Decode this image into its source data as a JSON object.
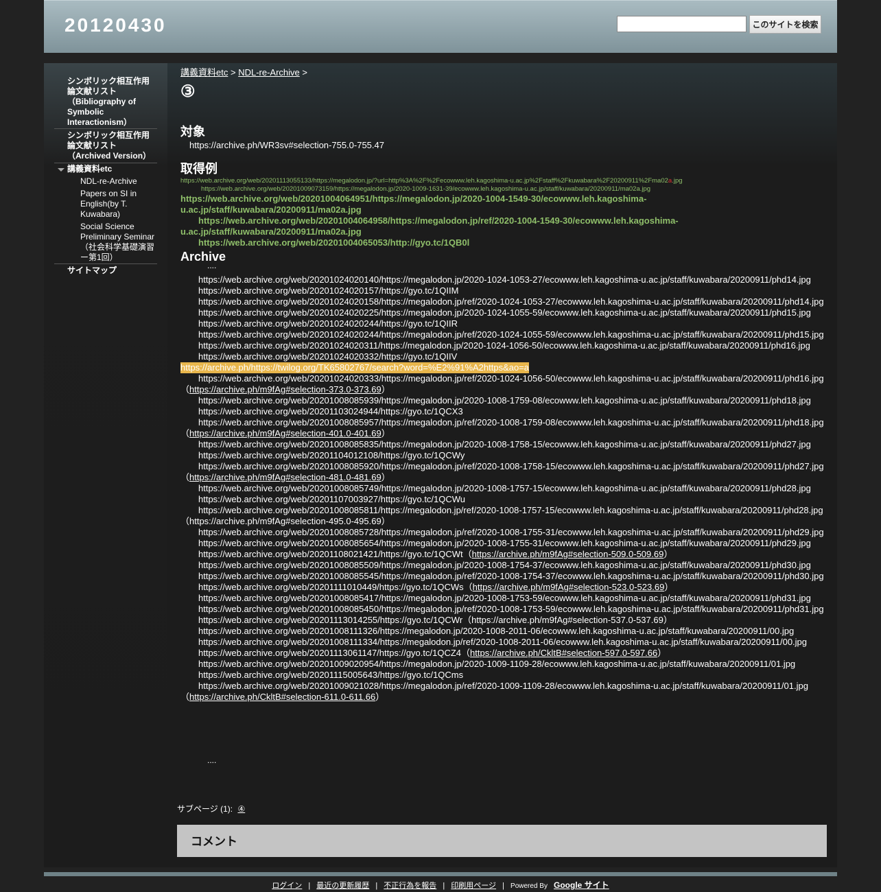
{
  "header": {
    "title": "20120430",
    "search_placeholder": "",
    "search_button": "このサイトを検索"
  },
  "sidebar": {
    "item1": [
      "シンボリック相互作用",
      "論文献リスト",
      "（Bibliography of",
      "Symbolic",
      "Interactionism）"
    ],
    "item2": [
      "シンボリック相互作用",
      "論文献リスト",
      "（Archived Version）"
    ],
    "item3": "講義資料etc",
    "sub1": "NDL-re-Archive",
    "sub2": [
      "Papers on SI in",
      "English(by T.",
      "Kuwabara)"
    ],
    "sub3": [
      "Social Science",
      "Preliminary Seminar",
      "（社会科学基礎演習",
      "ー第1回）"
    ],
    "item4": "サイトマップ"
  },
  "breadcrumb": {
    "a": "講義資料etc",
    "sep1": ">",
    "b": "NDL-re-Archive",
    "sep2": ">"
  },
  "page_title": "③",
  "section1": {
    "heading": "対象",
    "url": "https://archive.ph/WR3sv#selection-755.0-755.47"
  },
  "section2": {
    "heading": "取得例",
    "small1": "https://web.archive.org/web/20201113055133/https://megalodon.jp/?url=http%3A%2F%2Fecowww.leh.kagoshima-u.ac.jp%2Fstaff%2Fkuwabara%2F20200911%2Fma02",
    "small1_mark": "a",
    "small1_end": ".jpg",
    "small2": "https://web.archive.org/web/20201009073159/https://megalodon.jp/2020-1009-1631-39/ecowww.leh.kagoshima-u.ac.jp/staff/kuwabara/20200911/ma02a.jpg",
    "g1a": "https://web.archive.org/web/20201004064951/https://megalodon.jp/2020-1004-1549-30/ecowww.leh.kagoshima-",
    "g1b": "u.ac.jp/staff/kuwabara/20200911/ma02a.jpg",
    "g2a": "https://web.archive.org/web/20201004064958/https://megalodon.jp/ref/2020-1004-1549-30/ecowww.leh.kagoshima-",
    "g2b": "u.ac.jp/staff/kuwabara/20200911/ma02a.jpg",
    "g3": "https://web.archive.org/web/20201004065053/http://gyo.tc/1QB0l"
  },
  "archive": {
    "heading": "Archive",
    "dots": "....",
    "lines": [
      "https://web.archive.org/web/20201024020140/https://megalodon.jp/2020-1024-1053-27/ecowww.leh.kagoshima-u.ac.jp/staff/kuwabara/20200911/phd14.jpg",
      "https://web.archive.org/web/20201024020157/https://gyo.tc/1QIIM",
      "https://web.archive.org/web/20201024020158/https://megalodon.jp/ref/2020-1024-1053-27/ecowww.leh.kagoshima-u.ac.jp/staff/kuwabara/20200911/phd14.jpg",
      "https://web.archive.org/web/20201024020225/https://megalodon.jp/2020-1024-1055-59/ecowww.leh.kagoshima-u.ac.jp/staff/kuwabara/20200911/phd15.jpg",
      "https://web.archive.org/web/20201024020244/https://gyo.tc/1QIIR",
      "https://web.archive.org/web/20201024020244/https://megalodon.jp/ref/2020-1024-1055-59/ecowww.leh.kagoshima-u.ac.jp/staff/kuwabara/20200911/phd15.jpg",
      "https://web.archive.org/web/20201024020311/https://megalodon.jp/2020-1024-1056-50/ecowww.leh.kagoshima-u.ac.jp/staff/kuwabara/20200911/phd16.jpg",
      "https://web.archive.org/web/20201024020332/https://gyo.tc/1QIIV"
    ],
    "highlight": "https://archive.ph/https://twilog.org/TK65802767/search?word=%E2%91%A2https&ao=a",
    "l9": "https://web.archive.org/web/20201024020333/https://megalodon.jp/ref/2020-1024-1056-50/ecowww.leh.kagoshima-u.ac.jp/staff/kuwabara/20200911/phd16.jpg",
    "r9": "https://archive.ph/m9fAg#selection-373.0-373.69",
    "l10": "https://web.archive.org/web/20201008085939/https://megalodon.jp/2020-1008-1759-08/ecowww.leh.kagoshima-u.ac.jp/staff/kuwabara/20200911/phd18.jpg",
    "l11": "https://web.archive.org/web/20201103024944/https://gyo.tc/1QCX3",
    "l12": "https://web.archive.org/web/20201008085957/https://megalodon.jp/ref/2020-1008-1759-08/ecowww.leh.kagoshima-u.ac.jp/staff/kuwabara/20200911/phd18.jpg",
    "r12": "https://archive.ph/m9fAg#selection-401.0-401.69",
    "l13": "https://web.archive.org/web/20201008085835/https://megalodon.jp/2020-1008-1758-15/ecowww.leh.kagoshima-u.ac.jp/staff/kuwabara/20200911/phd27.jpg",
    "l14": "https://web.archive.org/web/20201104012108/https://gyo.tc/1QCWy",
    "l15": "https://web.archive.org/web/20201008085920/https://megalodon.jp/ref/2020-1008-1758-15/ecowww.leh.kagoshima-u.ac.jp/staff/kuwabara/20200911/phd27.jpg",
    "r15": "https://archive.ph/m9fAg#selection-481.0-481.69",
    "l16": "https://web.archive.org/web/20201008085749/https://megalodon.jp/2020-1008-1757-15/ecowww.leh.kagoshima-u.ac.jp/staff/kuwabara/20200911/phd28.jpg",
    "l17": "https://web.archive.org/web/20201107003927/https://gyo.tc/1QCWu",
    "l18": "https://web.archive.org/web/20201008085811/https://megalodon.jp/ref/2020-1008-1757-15/ecowww.leh.kagoshima-u.ac.jp/staff/kuwabara/20200911/phd28.jpg",
    "r18": "（https://archive.ph/m9fAg#selection-495.0-495.69）",
    "l19": "https://web.archive.org/web/20201008085728/https://megalodon.jp/ref/2020-1008-1755-31/ecowww.leh.kagoshima-u.ac.jp/staff/kuwabara/20200911/phd29.jpg",
    "l20": "https://web.archive.org/web/20201008085654/https://megalodon.jp/2020-1008-1755-31/ecowww.leh.kagoshima-u.ac.jp/staff/kuwabara/20200911/phd29.jpg",
    "l21": "https://web.archive.org/web/20201108021421/https://gyo.tc/1QCWt",
    "r21": "https://archive.ph/m9fAg#selection-509.0-509.69",
    "l22": "https://web.archive.org/web/20201008085509/https://megalodon.jp/2020-1008-1754-37/ecowww.leh.kagoshima-u.ac.jp/staff/kuwabara/20200911/phd30.jpg",
    "l23": "https://web.archive.org/web/20201008085545/https://megalodon.jp/ref/2020-1008-1754-37/ecowww.leh.kagoshima-u.ac.jp/staff/kuwabara/20200911/phd30.jpg",
    "l24": "https://web.archive.org/web/20201111010449/https://gyo.tc/1QCWs",
    "r24": "https://archive.ph/m9fAg#selection-523.0-523.69",
    "l25": "https://web.archive.org/web/20201008085417/https://megalodon.jp/2020-1008-1753-59/ecowww.leh.kagoshima-u.ac.jp/staff/kuwabara/20200911/phd31.jpg",
    "l26": "https://web.archive.org/web/20201008085450/https://megalodon.jp/ref/2020-1008-1753-59/ecowww.leh.kagoshima-u.ac.jp/staff/kuwabara/20200911/phd31.jpg",
    "l27": "https://web.archive.org/web/20201113014255/https://gyo.tc/1QCWr（https://archive.ph/m9fAg#selection-537.0-537.69）",
    "l28": "https://web.archive.org/web/20201008111326/https://megalodon.jp/2020-1008-2011-06/ecowww.leh.kagoshima-u.ac.jp/staff/kuwabara/20200911/00.jpg",
    "l29": "https://web.archive.org/web/20201008111334/https://megalodon.jp/ref/2020-1008-2011-06/ecowww.leh.kagoshima-u.ac.jp/staff/kuwabara/20200911/00.jpg",
    "l30": "https://web.archive.org/web/20201113061147/https://gyo.tc/1QCZ4",
    "r30": "https://archive.ph/CkltB#selection-597.0-597.66",
    "l31": "https://web.archive.org/web/20201009020954/https://megalodon.jp/2020-1009-1109-28/ecowww.leh.kagoshima-u.ac.jp/staff/kuwabara/20200911/01.jpg",
    "l32": "https://web.archive.org/web/20201115005643/https://gyo.tc/1QCms",
    "l33": "https://web.archive.org/web/20201009021028/https://megalodon.jp/ref/2020-1009-1109-28/ecowww.leh.kagoshima-u.ac.jp/staff/kuwabara/20200911/01.jpg",
    "r33": "https://archive.ph/CkltB#selection-611.0-611.66",
    "dots2": "...."
  },
  "subpages": {
    "label": "サブページ (1):",
    "link": "④"
  },
  "comment": {
    "title": "コメント"
  },
  "footer": {
    "login": "ログイン",
    "recent": "最近の更新履歴",
    "report": "不正行為を報告",
    "print": "印刷用ページ",
    "powered": "Powered By",
    "google": "Google サイト",
    "sep": "|"
  }
}
